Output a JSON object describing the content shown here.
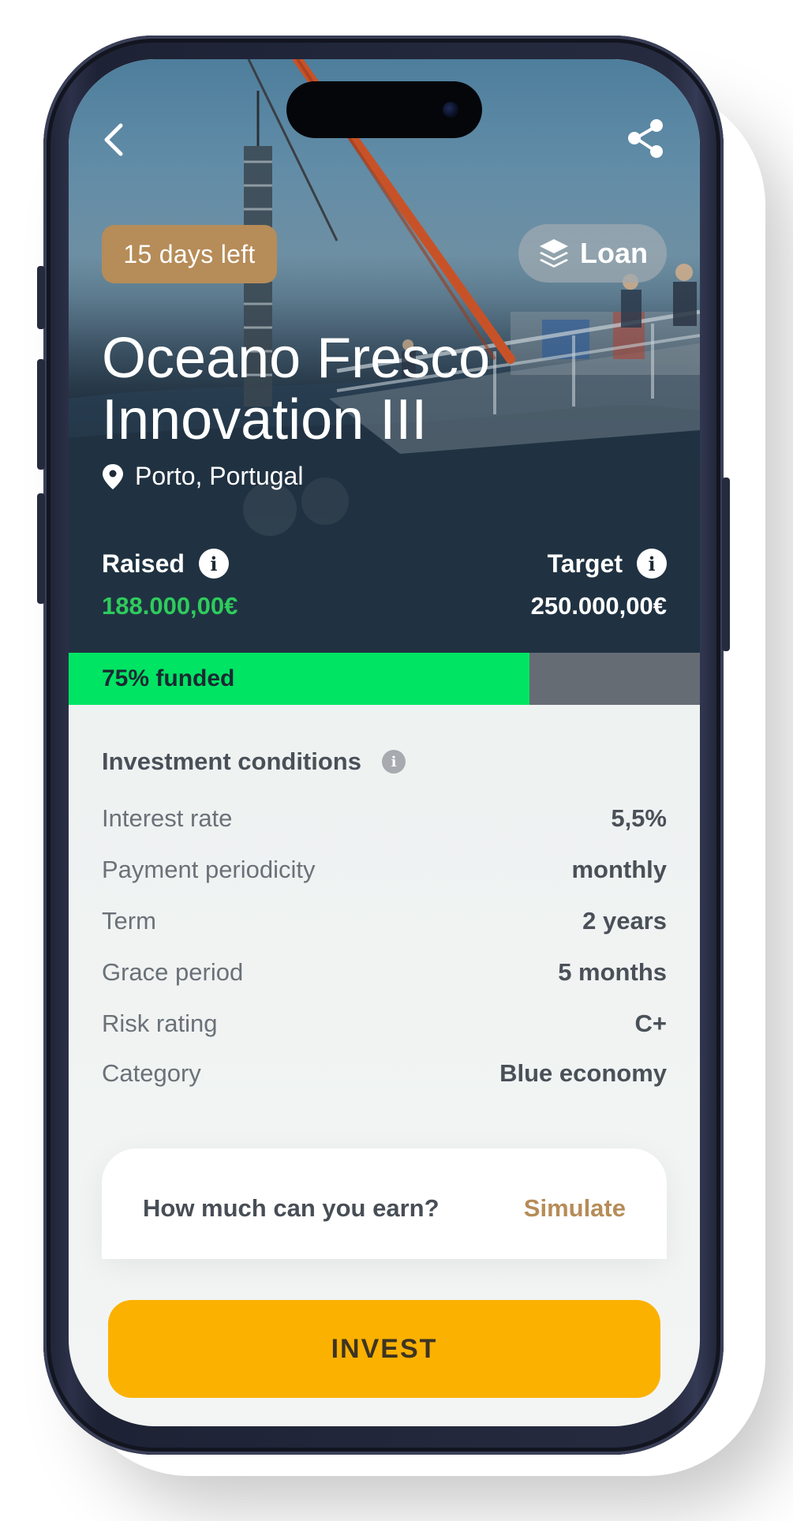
{
  "header": {
    "back_icon": "chevron-left-icon",
    "share_icon": "share-icon"
  },
  "project": {
    "days_left": "15 days left",
    "type_badge": "Loan",
    "type_icon": "layers-icon",
    "title_line1": "Oceano Fresco",
    "title_line2": "Innovation III",
    "location": "Porto, Portugal",
    "location_icon": "map-pin-icon"
  },
  "funding": {
    "raised_label": "Raised",
    "raised_value": "188.000,00€",
    "target_label": "Target",
    "target_value": "250.000,00€",
    "progress_fraction": 0.73,
    "progress_label": "75% funded",
    "progress_color": "#00e463",
    "raised_color": "#2ecc5c"
  },
  "conditions": {
    "title": "Investment conditions",
    "rows": [
      {
        "label": "Interest rate",
        "value": "5,5%"
      },
      {
        "label": "Payment periodicity",
        "value": "monthly"
      },
      {
        "label": "Term",
        "value": "2 years"
      },
      {
        "label": "Grace period",
        "value": "5 months"
      },
      {
        "label": "Risk rating",
        "value": "C+"
      },
      {
        "label": "Category",
        "value": "Blue economy"
      }
    ]
  },
  "simulate": {
    "question": "How much can you earn?",
    "link": "Simulate"
  },
  "actions": {
    "invest_label": "INVEST",
    "invest_color": "#fbb100"
  }
}
